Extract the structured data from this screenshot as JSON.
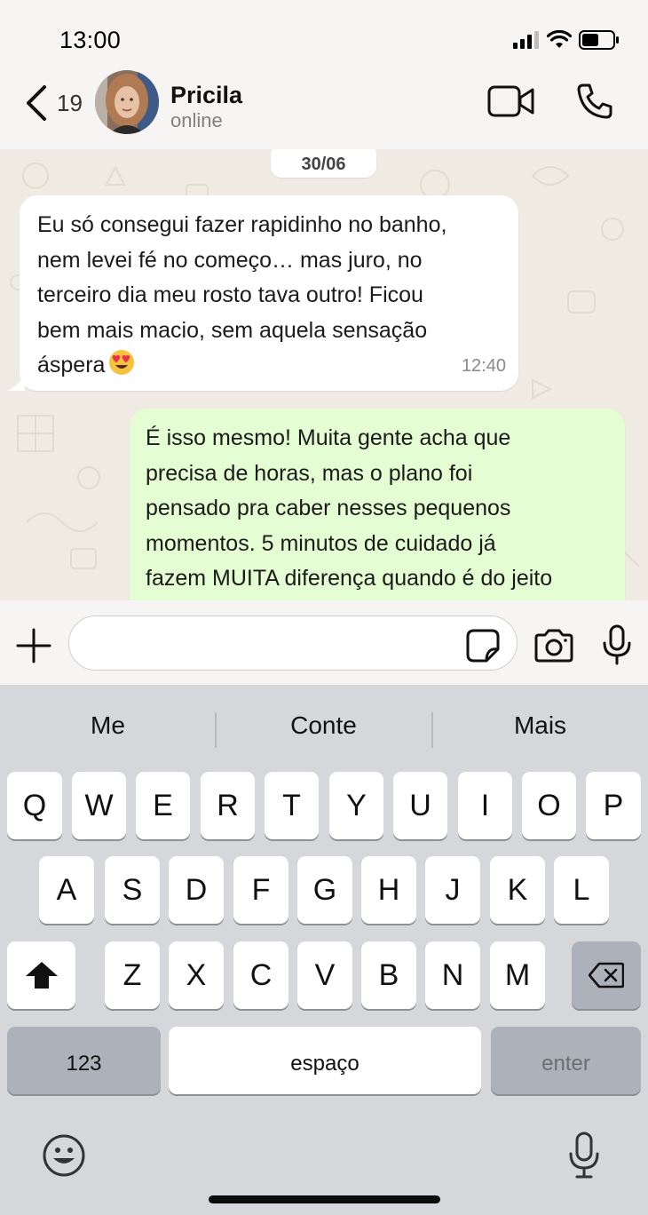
{
  "status_bar": {
    "time": "13:00"
  },
  "header": {
    "back_count": "19",
    "contact_name": "Pricila",
    "contact_status": "online"
  },
  "chat": {
    "date": "30/06",
    "messages": [
      {
        "direction": "incoming",
        "lines": [
          "Eu só consegui fazer rapidinho no banho,",
          "nem levei fé no começo… mas juro, no",
          "terceiro dia meu rosto tava outro! Ficou",
          "bem mais macio, sem aquela sensação",
          "áspera"
        ],
        "emoji": "heart-eyes",
        "time": "12:40"
      },
      {
        "direction": "outgoing",
        "lines": [
          "É isso mesmo! Muita gente acha que",
          "precisa de horas, mas o plano foi",
          "pensado pra caber nesses pequenos",
          "momentos. 5 minutos de cuidado já",
          "fazem MUITA diferença quando é do jeito"
        ]
      }
    ]
  },
  "input": {
    "placeholder": ""
  },
  "keyboard": {
    "suggestions": [
      "Me",
      "Conte",
      "Mais"
    ],
    "row1": [
      "Q",
      "W",
      "E",
      "R",
      "T",
      "Y",
      "U",
      "I",
      "O",
      "P"
    ],
    "row2": [
      "A",
      "S",
      "D",
      "F",
      "G",
      "H",
      "J",
      "K",
      "L"
    ],
    "row3": [
      "Z",
      "X",
      "C",
      "V",
      "B",
      "N",
      "M"
    ],
    "numbers_label": "123",
    "space_label": "espaço",
    "enter_label": "enter"
  },
  "colors": {
    "outgoing_bubble": "#e4fdd2",
    "incoming_bubble": "#ffffff",
    "chat_background": "#efeae2",
    "keyboard_background": "#d6d7db"
  },
  "icons": [
    "chevron-left-icon",
    "video-icon",
    "phone-icon",
    "plus-icon",
    "sticker-icon",
    "camera-icon",
    "mic-icon",
    "shift-icon",
    "backspace-icon",
    "emoji-icon",
    "dictation-icon",
    "signal-icon",
    "wifi-icon",
    "battery-icon"
  ]
}
